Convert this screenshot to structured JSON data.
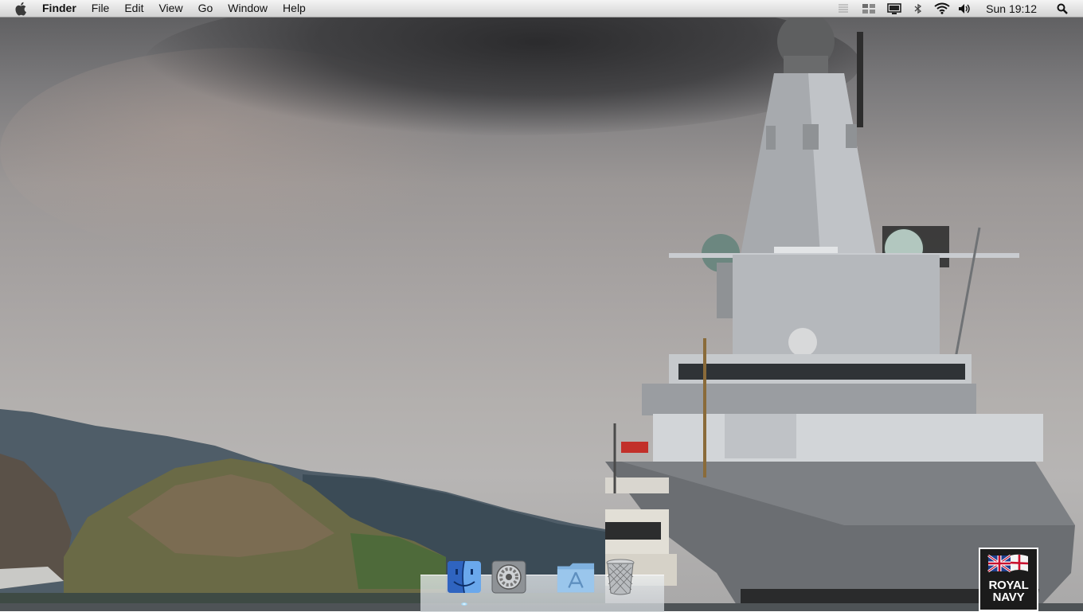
{
  "menubar": {
    "app_name": "Finder",
    "items": [
      "File",
      "Edit",
      "View",
      "Go",
      "Window",
      "Help"
    ],
    "status_icons": [
      "page-icon",
      "spaces-icon",
      "display-icon",
      "bluetooth-icon",
      "wifi-icon",
      "volume-icon"
    ],
    "clock": "Sun 19:12"
  },
  "dock": {
    "items": [
      {
        "name": "Finder",
        "icon": "finder-icon",
        "running": true
      },
      {
        "name": "System Preferences",
        "icon": "system-preferences-icon",
        "running": false
      },
      {
        "name": "Applications",
        "icon": "applications-folder-icon",
        "running": false
      },
      {
        "name": "Trash",
        "icon": "trash-icon",
        "running": false
      }
    ]
  },
  "wallpaper": {
    "logo_line1": "ROYAL",
    "logo_line2": "NAVY"
  }
}
